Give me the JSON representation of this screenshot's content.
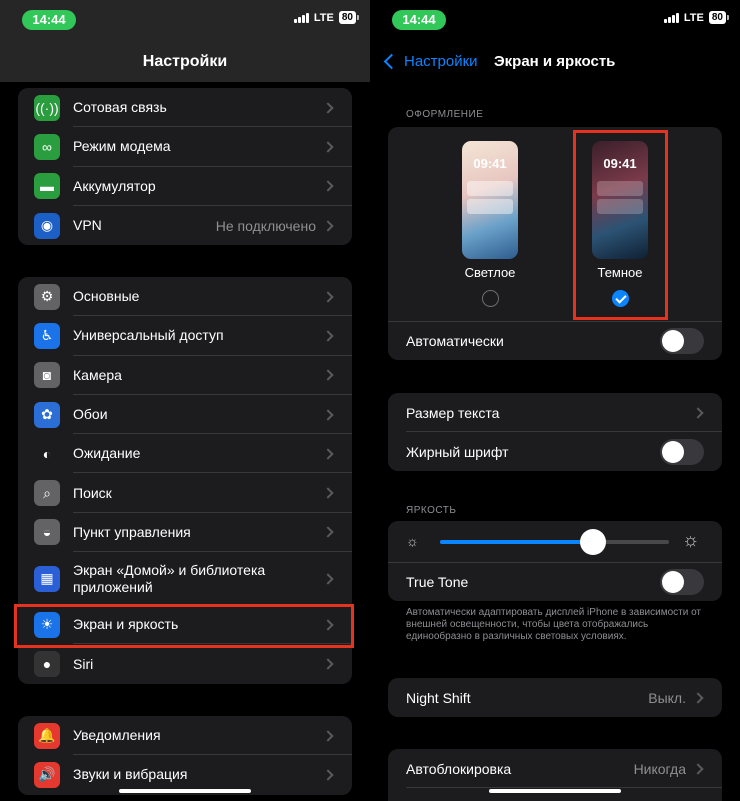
{
  "status": {
    "time": "14:44",
    "network": "LTE",
    "battery": "80"
  },
  "left": {
    "title": "Настройки",
    "group1": [
      {
        "icon": "antenna-icon",
        "glyph": "((·))",
        "color": "#2a9d3e",
        "label": "Сотовая связь"
      },
      {
        "icon": "chain-link-icon",
        "glyph": "∞",
        "color": "#2a9d3e",
        "label": "Режим модема"
      },
      {
        "icon": "battery-icon",
        "glyph": "▬",
        "color": "#2a9d3e",
        "label": "Аккумулятор"
      },
      {
        "icon": "globe-icon",
        "glyph": "◉",
        "color": "#1c5fc7",
        "label": "VPN",
        "value": "Не подключено"
      }
    ],
    "group2": [
      {
        "icon": "gear-icon",
        "glyph": "⚙",
        "color": "#636366",
        "label": "Основные"
      },
      {
        "icon": "accessibility-icon",
        "glyph": "♿",
        "color": "#1a73e8",
        "label": "Универсальный доступ"
      },
      {
        "icon": "camera-icon",
        "glyph": "◙",
        "color": "#636366",
        "label": "Камера"
      },
      {
        "icon": "wallpaper-icon",
        "glyph": "✿",
        "color": "#2b6fd6",
        "label": "Обои"
      },
      {
        "icon": "standby-icon",
        "glyph": "◐",
        "color": "#1c1c1e",
        "label": "Ожидание"
      },
      {
        "icon": "search-icon",
        "glyph": "⌕",
        "color": "#636366",
        "label": "Поиск"
      },
      {
        "icon": "control-center-icon",
        "glyph": "◒",
        "color": "#636366",
        "label": "Пункт управления"
      },
      {
        "icon": "home-screen-icon",
        "glyph": "▦",
        "color": "#2b5fd6",
        "label": "Экран «Домой» и библиотека приложений"
      },
      {
        "icon": "sun-icon",
        "glyph": "☀",
        "color": "#1a73e8",
        "label": "Экран и яркость"
      },
      {
        "icon": "siri-icon",
        "glyph": "●",
        "color": "#333",
        "label": "Siri"
      }
    ],
    "group3": [
      {
        "icon": "bell-icon",
        "glyph": "🔔",
        "color": "#e5382f",
        "label": "Уведомления"
      },
      {
        "icon": "speaker-icon",
        "glyph": "🔊",
        "color": "#e5382f",
        "label": "Звуки и вибрация"
      }
    ]
  },
  "right": {
    "back_label": "Настройки",
    "title": "Экран и яркость",
    "appearance_section": "ОФОРМЛЕНИЕ",
    "phone_time": "09:41",
    "light_label": "Светлое",
    "dark_label": "Темное",
    "selected": "dark",
    "automatic_label": "Автоматически",
    "text_size_label": "Размер текста",
    "bold_text_label": "Жирный шрифт",
    "brightness_section": "ЯРКОСТЬ",
    "brightness_level": 0.67,
    "true_tone_label": "True Tone",
    "true_tone_note": "Автоматически адаптировать дисплей iPhone в зависимости от внешней освещенности, чтобы цвета отображались единообразно в различных световых условиях.",
    "night_shift_label": "Night Shift",
    "night_shift_value": "Выкл.",
    "autolock_label": "Автоблокировка",
    "autolock_value": "Никогда"
  },
  "colors": {
    "accent": "#0a84ff",
    "highlight": "#e5331f",
    "status_pill": "#32c759"
  }
}
